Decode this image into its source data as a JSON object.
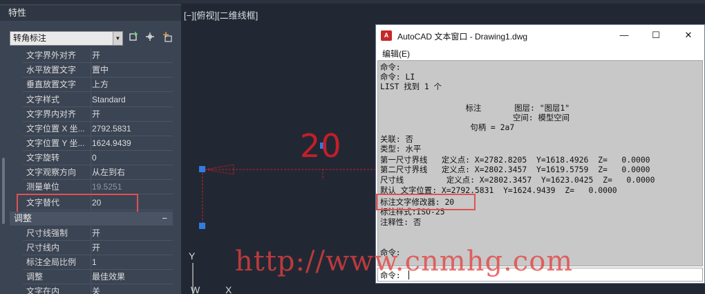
{
  "properties_palette": {
    "title": "特性",
    "object_type": "转角标注",
    "toolbar_icons": [
      "quick-select-icon",
      "pick-point-icon",
      "toggle-pickadd-icon"
    ],
    "rows": [
      {
        "label": "文字界外对齐",
        "value": "开"
      },
      {
        "label": "水平放置文字",
        "value": "置中"
      },
      {
        "label": "垂直放置文字",
        "value": "上方"
      },
      {
        "label": "文字样式",
        "value": "Standard"
      },
      {
        "label": "文字界内对齐",
        "value": "开"
      },
      {
        "label": "文字位置 X 坐...",
        "value": "2792.5831"
      },
      {
        "label": "文字位置 Y 坐...",
        "value": "1624.9439"
      },
      {
        "label": "文字旋转",
        "value": "0"
      },
      {
        "label": "文字观察方向",
        "value": "从左到右"
      },
      {
        "label": "测量单位",
        "value": "19.5251"
      },
      {
        "label": "文字替代",
        "value": "20"
      }
    ],
    "section_fit": {
      "title": "调整",
      "collapse_symbol": "−",
      "rows": [
        {
          "label": "尺寸线强制",
          "value": "开"
        },
        {
          "label": "尺寸线内",
          "value": "开"
        },
        {
          "label": "标注全局比例",
          "value": "1"
        },
        {
          "label": "调整",
          "value": "最佳效果"
        },
        {
          "label": "文字在内",
          "value": "关"
        }
      ]
    }
  },
  "viewport": {
    "label": "[−][俯视][二维线框]",
    "dimension_text": "20",
    "ucs_labels": {
      "y": "Y",
      "w": "W",
      "x": "X"
    },
    "colors": {
      "dimension": "#c41e2a",
      "grip": "#2f7de1"
    }
  },
  "text_window": {
    "title": "AutoCAD 文本窗口 - Drawing1.dwg",
    "controls": {
      "minimize": "—",
      "maximize": "☐",
      "close": "✕"
    },
    "menu_edit": "编辑(E)",
    "lines": [
      "命令:",
      "命令: LI",
      "LIST 找到 1 个",
      "",
      "                  标注       图层: \"图层1\"",
      "                            空间: 模型空间",
      "                   句柄 = 2a7",
      "",
      "关联: 否",
      "类型: 水平",
      "第一尺寸界线   定义点: X=2782.8205  Y=1618.4926  Z=   0.0000",
      "第二尺寸界线   定义点: X=2802.3457  Y=1619.5759  Z=   0.0000",
      "尺寸线         定义点: X=2802.3457  Y=1623.0425  Z=   0.0000",
      "默认 文字位置: X=2792.5831  Y=1624.9439  Z=   0.0000",
      "标注文字修改器: 20",
      "标注样式:ISO-25",
      "注释性: 否",
      "",
      "",
      "命令:"
    ],
    "command_prompt": "命令:"
  },
  "watermark": "http://www.cnmhg.com"
}
